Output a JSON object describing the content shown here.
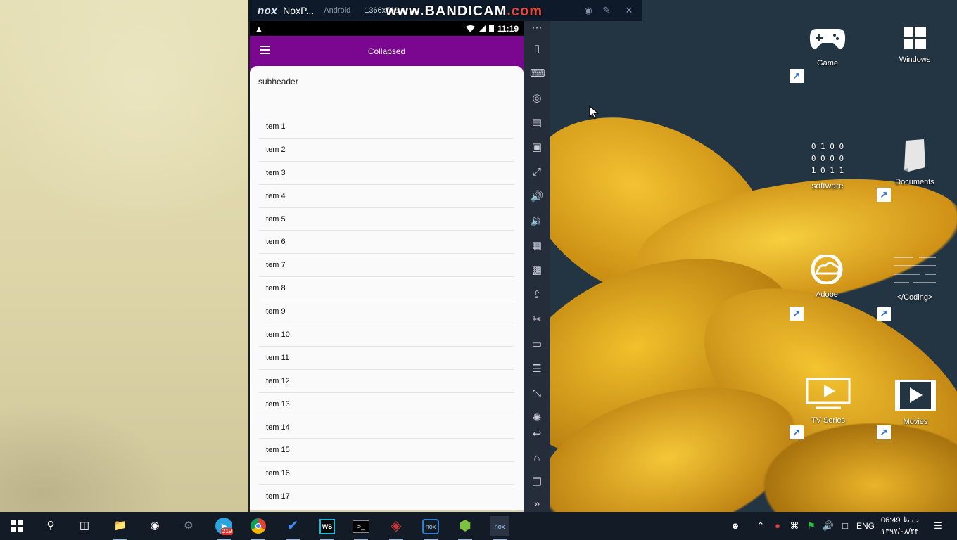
{
  "nox_window": {
    "logo": "nox",
    "app_name": "NoxP...",
    "mode_text": "Android",
    "resolution": "1366x768",
    "recording_watermark": "www.BANDICAM",
    "recording_watermark_suffix": ".com"
  },
  "status_bar": {
    "time": "11:19"
  },
  "app_bar": {
    "title": "Collapsed"
  },
  "page": {
    "subheader": "subheader",
    "items": [
      "Item 1",
      "Item 2",
      "Item 3",
      "Item 4",
      "Item 5",
      "Item 6",
      "Item 7",
      "Item 8",
      "Item 9",
      "Item 10",
      "Item 11",
      "Item 12",
      "Item 13",
      "Item 14",
      "Item 15",
      "Item 16",
      "Item 17"
    ]
  },
  "desktop_icons": {
    "game": "Game",
    "windows": "Windows",
    "software": "software",
    "documents": "Documents",
    "adobe": "Adobe",
    "coding": "</Coding>",
    "tv_series": "TV Series",
    "movies": "Movies",
    "software_glyph_rows": [
      "0 1 0 0",
      "0 0 0 0",
      "1 0 1 1"
    ]
  },
  "taskbar": {
    "telegram_badge": "219",
    "language": "ENG",
    "clock_time": "06:49 ب.ظ",
    "clock_date": "۱۳۹۷/۰۸/۲۴"
  },
  "colors": {
    "app_bar": "#7b0791",
    "toolbar": "#262d3a",
    "taskbar": "#121b26"
  }
}
